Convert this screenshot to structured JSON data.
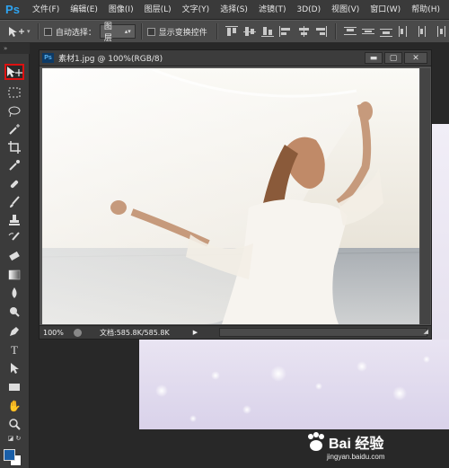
{
  "app": {
    "logo": "Ps"
  },
  "menubar": {
    "items": [
      "文件(F)",
      "编辑(E)",
      "图像(I)",
      "图层(L)",
      "文字(Y)",
      "选择(S)",
      "滤镜(T)",
      "3D(D)",
      "视图(V)",
      "窗口(W)",
      "帮助(H)"
    ]
  },
  "options": {
    "auto_select_label": "自动选择：",
    "auto_select_target": "图层",
    "show_transform_label": "显示变换控件"
  },
  "document": {
    "title": "素材1.jpg @ 100%(RGB/8)",
    "zoom": "100%",
    "doc_size": "文档:585.8K/585.8K"
  },
  "colors": {
    "foreground": "#1a5fa8",
    "background": "#ffffff",
    "active_tool_highlight": "#dd1111"
  },
  "watermark": {
    "brand": "Bai 经验",
    "url": "jingyan.baidu.com"
  }
}
